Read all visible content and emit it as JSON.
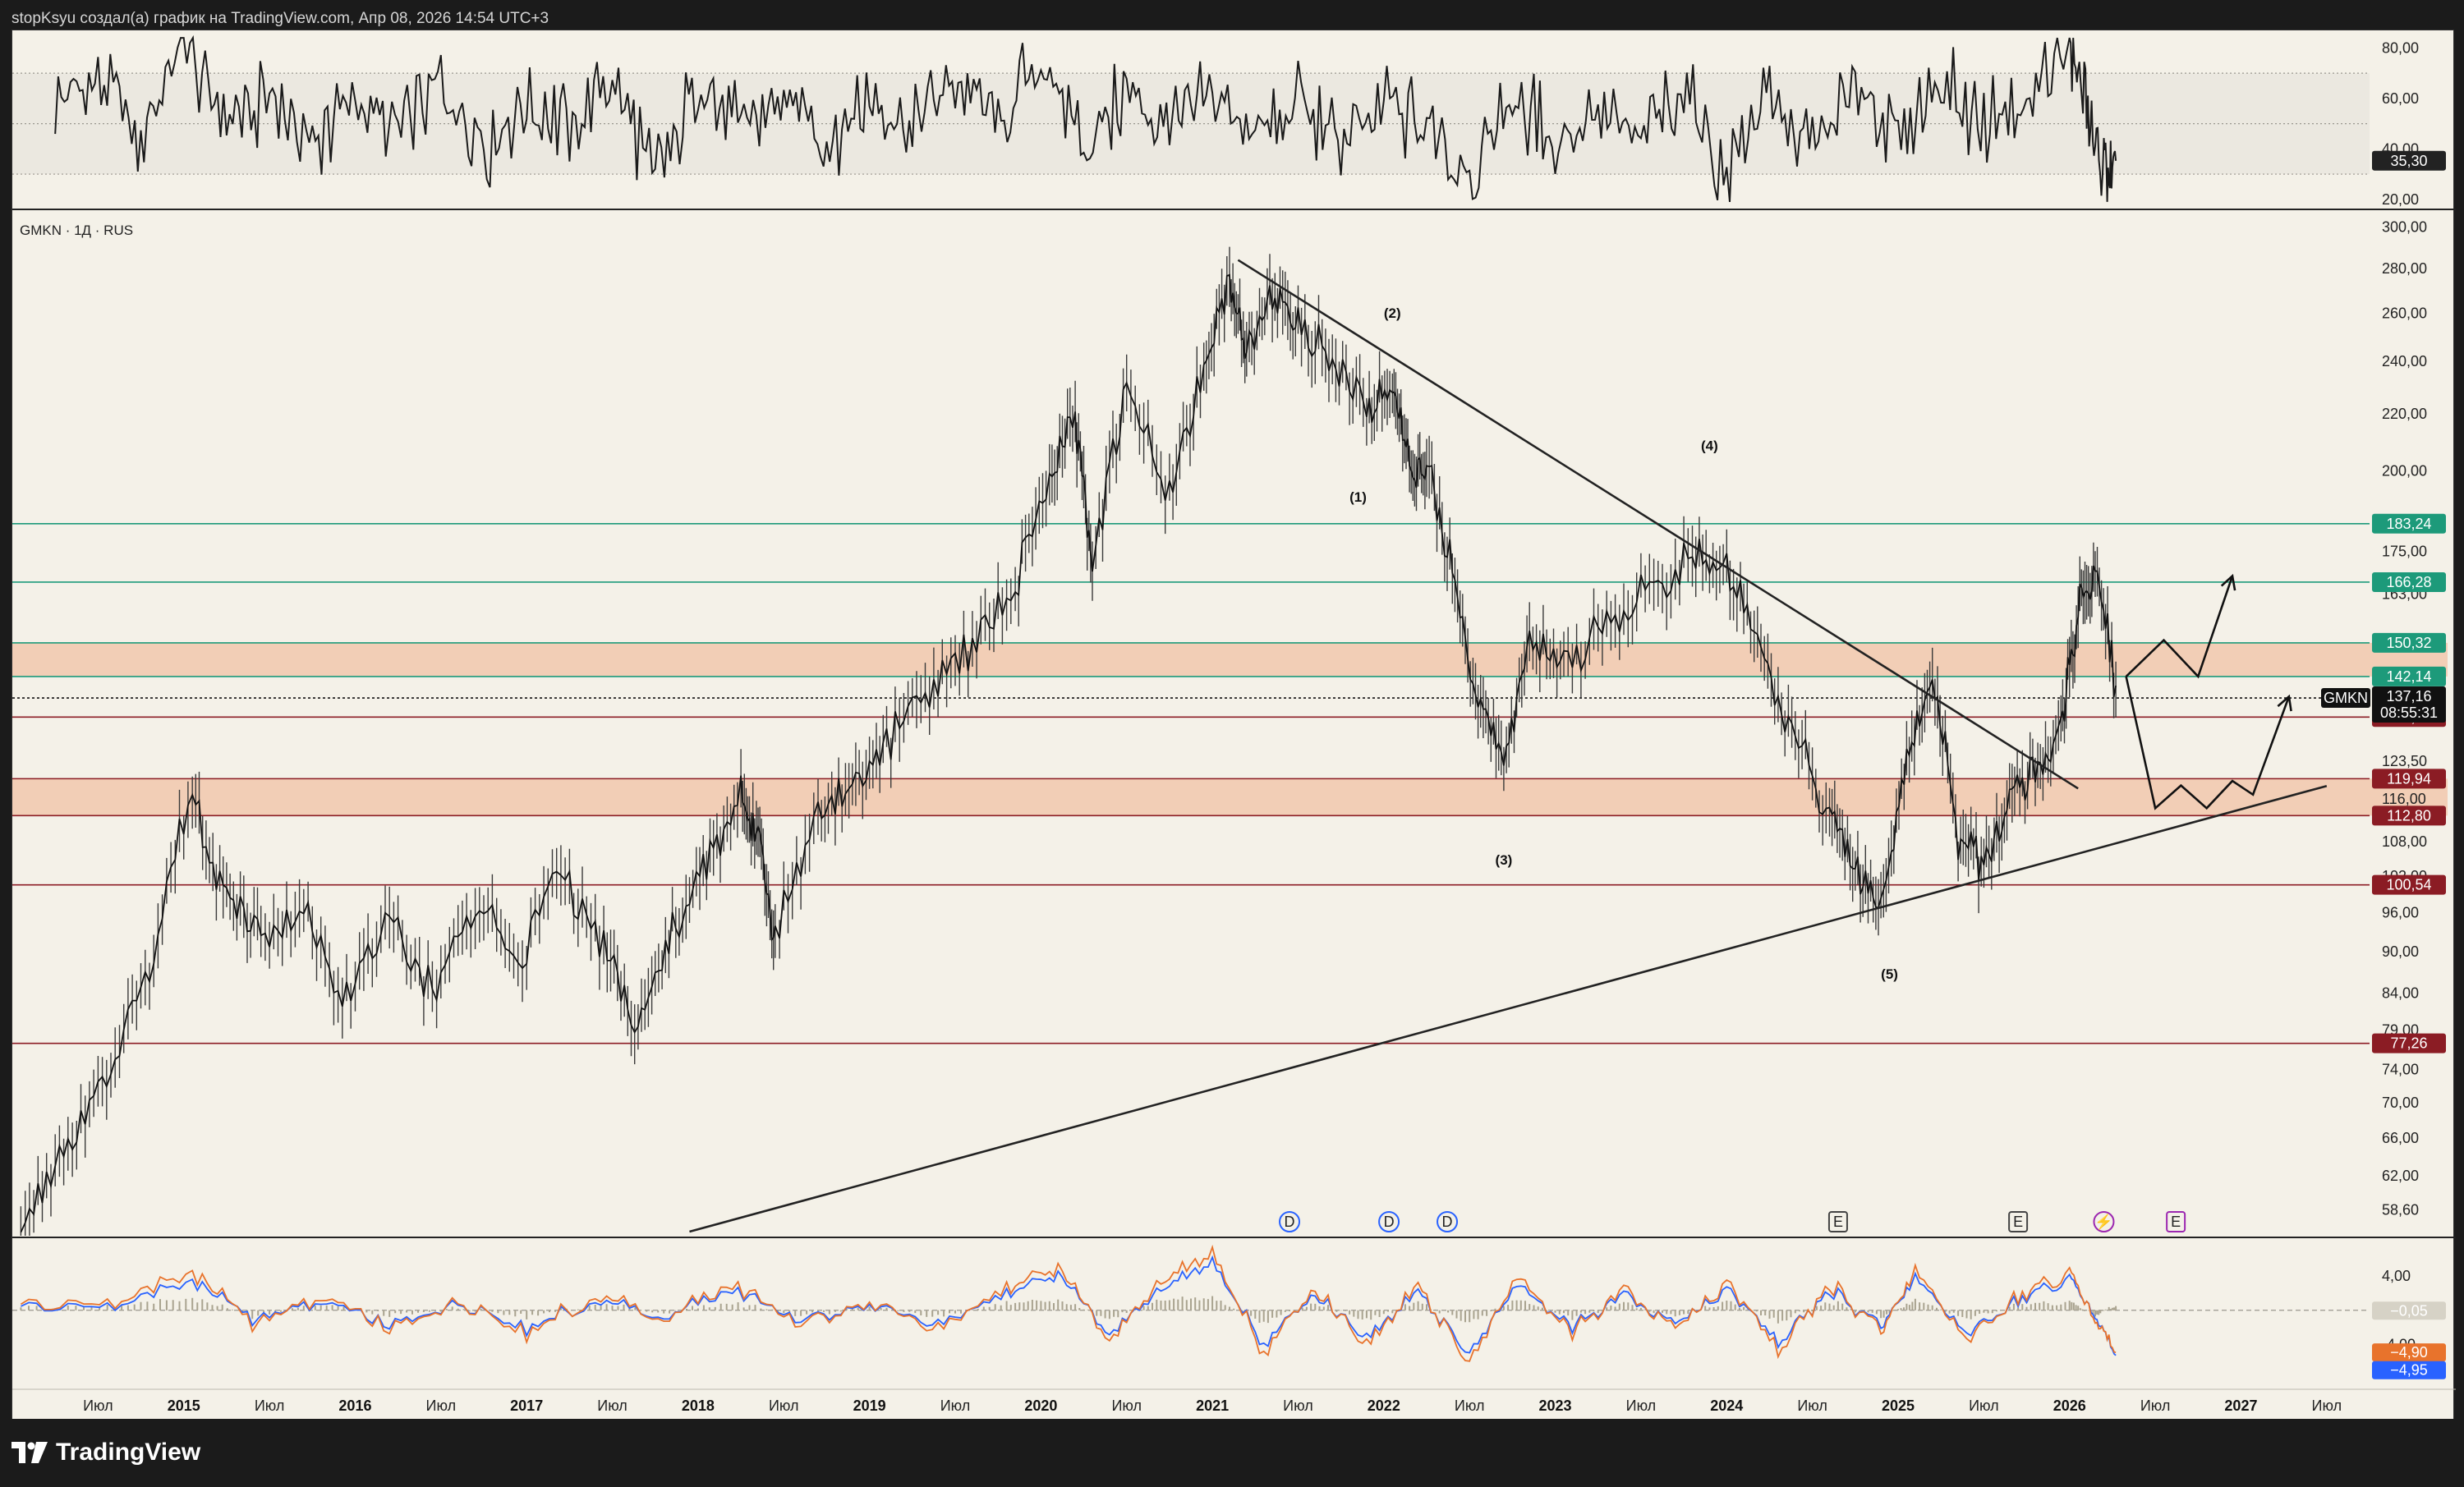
{
  "header": {
    "caption": "stopKsyu создал(а) график на TradingView.com, Апр 08, 2026 14:54 UTC+3"
  },
  "brand": {
    "name": "TradingView"
  },
  "symbol_info": "GMKN · 1Д · RUS",
  "colors": {
    "background": "#f4f1e8",
    "resistance_green": "#1d9a7a",
    "support_red": "#8b1c24",
    "zone_fill": "#f2c2a6",
    "price_line": "#111111",
    "macd_fast": "#e8732c",
    "macd_slow": "#2962ff",
    "price_tag": "#111111"
  },
  "chart_data": [
    {
      "type": "line",
      "panel": "rsi",
      "y_ticks": [
        "80,00",
        "60,00",
        "40,00",
        "20,00"
      ],
      "ylim": [
        17,
        86
      ],
      "guides": [
        70,
        50,
        30
      ],
      "current": {
        "value": 35.3,
        "label": "35,30"
      },
      "approx_series": {
        "x": [
          2014.25,
          2014.5,
          2014.75,
          2015.0,
          2015.25,
          2015.5,
          2015.75,
          2016.0,
          2016.25,
          2016.5,
          2016.75,
          2017.0,
          2017.25,
          2017.5,
          2017.75,
          2018.0,
          2018.25,
          2018.5,
          2018.75,
          2019.0,
          2019.25,
          2019.5,
          2019.75,
          2020.0,
          2020.25,
          2020.5,
          2020.75,
          2021.0,
          2021.25,
          2021.5,
          2021.75,
          2022.0,
          2022.25,
          2022.5,
          2022.75,
          2023.0,
          2023.25,
          2023.5,
          2023.75,
          2024.0,
          2024.25,
          2024.5,
          2024.75,
          2025.0,
          2025.25,
          2025.5,
          2025.75,
          2026.0,
          2026.1,
          2026.2,
          2026.27
        ],
        "y": [
          58,
          66,
          45,
          82,
          50,
          60,
          42,
          62,
          46,
          64,
          40,
          58,
          50,
          66,
          30,
          64,
          48,
          60,
          44,
          62,
          46,
          66,
          48,
          78,
          40,
          64,
          48,
          62,
          46,
          58,
          44,
          56,
          50,
          32,
          62,
          44,
          56,
          46,
          64,
          30,
          60,
          42,
          62,
          44,
          66,
          48,
          60,
          80,
          60,
          30,
          35.3
        ]
      }
    },
    {
      "type": "line",
      "panel": "price",
      "symbol": "GMKN",
      "scale": "log",
      "x_ticks": [
        "Июл",
        "2015",
        "Июл",
        "2016",
        "Июл",
        "2017",
        "Июл",
        "2018",
        "Июл",
        "2019",
        "Июл",
        "2020",
        "Июл",
        "2021",
        "Июл",
        "2022",
        "Июл",
        "2023",
        "Июл",
        "2024",
        "Июл",
        "2025",
        "Июл",
        "2026",
        "Июл",
        "2027",
        "Июл"
      ],
      "x_tick_years": [
        2014.5,
        2015.0,
        2015.5,
        2016.0,
        2016.5,
        2017.0,
        2017.5,
        2018.0,
        2018.5,
        2019.0,
        2019.5,
        2020.0,
        2020.5,
        2021.0,
        2021.5,
        2022.0,
        2022.5,
        2023.0,
        2023.5,
        2024.0,
        2024.5,
        2025.0,
        2025.5,
        2026.0,
        2026.5,
        2027.0,
        2027.5
      ],
      "y_ticks": [
        "300,00",
        "280,00",
        "260,00",
        "240,00",
        "220,00",
        "200,00",
        "175,00",
        "163,00",
        "123,50",
        "116,00",
        "108,00",
        "102,00",
        "96,00",
        "90,00",
        "84,00",
        "79,00",
        "74,00",
        "70,00",
        "66,00",
        "62,00",
        "58,60"
      ],
      "y_tick_values": [
        300,
        280,
        260,
        240,
        220,
        200,
        175,
        163,
        123.5,
        116,
        108,
        102,
        96,
        90,
        84,
        79,
        74,
        70,
        66,
        62,
        58.6
      ],
      "ylim": [
        56.5,
        306
      ],
      "levels": [
        {
          "value": 183.24,
          "label": "183,24",
          "color": "#1d9a7a"
        },
        {
          "value": 166.28,
          "label": "166,28",
          "color": "#1d9a7a"
        },
        {
          "value": 150.32,
          "label": "150,32",
          "color": "#1d9a7a"
        },
        {
          "value": 142.14,
          "label": "142,14",
          "color": "#1d9a7a"
        },
        {
          "value": 132.88,
          "label": "132,88",
          "color": "#8b1c24"
        },
        {
          "value": 119.94,
          "label": "119,94",
          "color": "#8b1c24"
        },
        {
          "value": 112.8,
          "label": "112,80",
          "color": "#8b1c24"
        },
        {
          "value": 100.54,
          "label": "100,54",
          "color": "#8b1c24"
        },
        {
          "value": 77.26,
          "label": "77,26",
          "color": "#8b1c24"
        }
      ],
      "zones": [
        {
          "from": 142.14,
          "to": 150.32
        },
        {
          "from": 112.8,
          "to": 119.94
        }
      ],
      "current": {
        "symbol": "GMKN",
        "value": 137.16,
        "label": "137,16",
        "countdown": "08:55:31"
      },
      "trendlines": [
        {
          "from": [
            2021.15,
            284
          ],
          "to": [
            2026.05,
            118
          ]
        },
        {
          "from": [
            2017.95,
            56.5
          ],
          "to": [
            2027.5,
            118.5
          ]
        }
      ],
      "wave_labels": [
        {
          "text": "(1)",
          "x": 2021.85,
          "y": 190
        },
        {
          "text": "(2)",
          "x": 2022.05,
          "y": 258
        },
        {
          "text": "(3)",
          "x": 2022.7,
          "y": 104
        },
        {
          "text": "(4)",
          "x": 2023.9,
          "y": 207
        },
        {
          "text": "(5)",
          "x": 2024.95,
          "y": 86
        }
      ],
      "projection_paths": [
        [
          [
            2026.33,
            142.14
          ],
          [
            2026.55,
            151
          ],
          [
            2026.75,
            142.14
          ],
          [
            2026.95,
            168
          ]
        ],
        [
          [
            2026.33,
            142.14
          ],
          [
            2026.5,
            114.2
          ],
          [
            2026.65,
            118.6
          ],
          [
            2026.8,
            114.2
          ],
          [
            2026.95,
            119.5
          ],
          [
            2027.07,
            116.8
          ],
          [
            2027.28,
            137.5
          ]
        ]
      ],
      "approx_series": {
        "x": [
          2014.05,
          2014.3,
          2014.55,
          2014.8,
          2015.05,
          2015.25,
          2015.45,
          2015.7,
          2015.95,
          2016.2,
          2016.45,
          2016.7,
          2016.95,
          2017.2,
          2017.45,
          2017.65,
          2017.85,
          2018.05,
          2018.25,
          2018.35,
          2018.45,
          2018.7,
          2018.9,
          2019.1,
          2019.35,
          2019.6,
          2019.85,
          2020.05,
          2020.2,
          2020.3,
          2020.5,
          2020.75,
          2020.95,
          2021.1,
          2021.2,
          2021.35,
          2021.5,
          2021.7,
          2021.9,
          2022.05,
          2022.15,
          2022.25,
          2022.4,
          2022.55,
          2022.7,
          2022.85,
          2023.05,
          2023.3,
          2023.55,
          2023.8,
          2024.0,
          2024.2,
          2024.4,
          2024.6,
          2024.75,
          2024.9,
          2025.05,
          2025.2,
          2025.35,
          2025.5,
          2025.65,
          2025.8,
          2025.95,
          2026.05,
          2026.15,
          2026.27
        ],
        "y": [
          57,
          64,
          72,
          88,
          117,
          98,
          92,
          96,
          84,
          94,
          84,
          98,
          88,
          104,
          90,
          79,
          92,
          104,
          116,
          110,
          92,
          114,
          118,
          128,
          140,
          150,
          165,
          196,
          220,
          170,
          230,
          190,
          235,
          275,
          240,
          268,
          255,
          240,
          220,
          230,
          205,
          200,
          170,
          135,
          125,
          150,
          145,
          155,
          165,
          175,
          170,
          148,
          128,
          112,
          102,
          95,
          122,
          142,
          108,
          104,
          116,
          122,
          130,
          158,
          168,
          140
        ]
      }
    },
    {
      "type": "line",
      "panel": "macd",
      "y_ticks": [
        "4,00",
        "0,00",
        "-4,00"
      ],
      "ylim": [
        -9,
        8
      ],
      "values": [
        {
          "value": -0.05,
          "label": "−0,05",
          "color": "#d6d2c6"
        },
        {
          "value": -4.9,
          "label": "−4,90",
          "color": "#e8732c"
        },
        {
          "value": -5.25,
          "label": "−4,95",
          "color": "#2962ff"
        }
      ],
      "series": [
        {
          "name": "",
          "color": "#e8732c",
          "x": [
            2014.05,
            2014.6,
            2015.05,
            2015.4,
            2015.8,
            2016.2,
            2016.6,
            2017.0,
            2017.4,
            2017.8,
            2018.2,
            2018.6,
            2019.0,
            2019.4,
            2019.8,
            2020.1,
            2020.4,
            2020.7,
            2021.0,
            2021.3,
            2021.6,
            2021.9,
            2022.2,
            2022.5,
            2022.8,
            2023.1,
            2023.4,
            2023.7,
            2024.0,
            2024.3,
            2024.6,
            2024.9,
            2025.1,
            2025.4,
            2025.7,
            2026.0,
            2026.15,
            2026.27
          ],
          "y": [
            0.5,
            1.0,
            4.5,
            -1.5,
            1.5,
            -2.0,
            1.0,
            -2.5,
            1.5,
            -1.0,
            3.0,
            -1.5,
            1.0,
            -2.0,
            2.5,
            5.0,
            -3.5,
            3.5,
            6.5,
            -5.0,
            2.5,
            -4.0,
            3.0,
            -6.0,
            4.0,
            -2.5,
            2.5,
            -2.0,
            3.5,
            -4.5,
            3.0,
            -2.5,
            4.5,
            -3.0,
            1.5,
            4.5,
            -1.0,
            -4.9
          ]
        },
        {
          "name": "",
          "color": "#2962ff",
          "x": [
            2014.05,
            2014.6,
            2015.05,
            2015.4,
            2015.8,
            2016.2,
            2016.6,
            2017.0,
            2017.4,
            2017.8,
            2018.2,
            2018.6,
            2019.0,
            2019.4,
            2019.8,
            2020.1,
            2020.4,
            2020.7,
            2021.0,
            2021.3,
            2021.6,
            2021.9,
            2022.2,
            2022.5,
            2022.8,
            2023.1,
            2023.4,
            2023.7,
            2024.0,
            2024.3,
            2024.6,
            2024.9,
            2025.1,
            2025.4,
            2025.7,
            2026.0,
            2026.15,
            2026.27
          ],
          "y": [
            0.3,
            0.6,
            3.5,
            -1.0,
            1.0,
            -1.6,
            0.8,
            -2.0,
            1.0,
            -0.8,
            2.4,
            -1.1,
            0.7,
            -1.5,
            1.9,
            4.2,
            -2.8,
            2.6,
            5.5,
            -4.0,
            1.9,
            -3.2,
            2.3,
            -5.0,
            3.1,
            -1.9,
            1.9,
            -1.5,
            2.7,
            -3.6,
            2.3,
            -1.9,
            3.7,
            -2.4,
            1.1,
            3.8,
            -0.6,
            -5.25
          ]
        }
      ]
    }
  ],
  "event_markers": [
    {
      "type": "dividend",
      "symbol": "D",
      "x": 2021.45
    },
    {
      "type": "dividend",
      "symbol": "D",
      "x": 2022.03
    },
    {
      "type": "dividend",
      "symbol": "D",
      "x": 2022.37
    },
    {
      "type": "earnings",
      "symbol": "E",
      "x": 2024.65
    },
    {
      "type": "earnings",
      "symbol": "E",
      "x": 2025.7
    },
    {
      "type": "split",
      "symbol": "⚡",
      "x": 2026.2
    },
    {
      "type": "earnings-upcoming",
      "symbol": "E",
      "x": 2026.62
    }
  ]
}
